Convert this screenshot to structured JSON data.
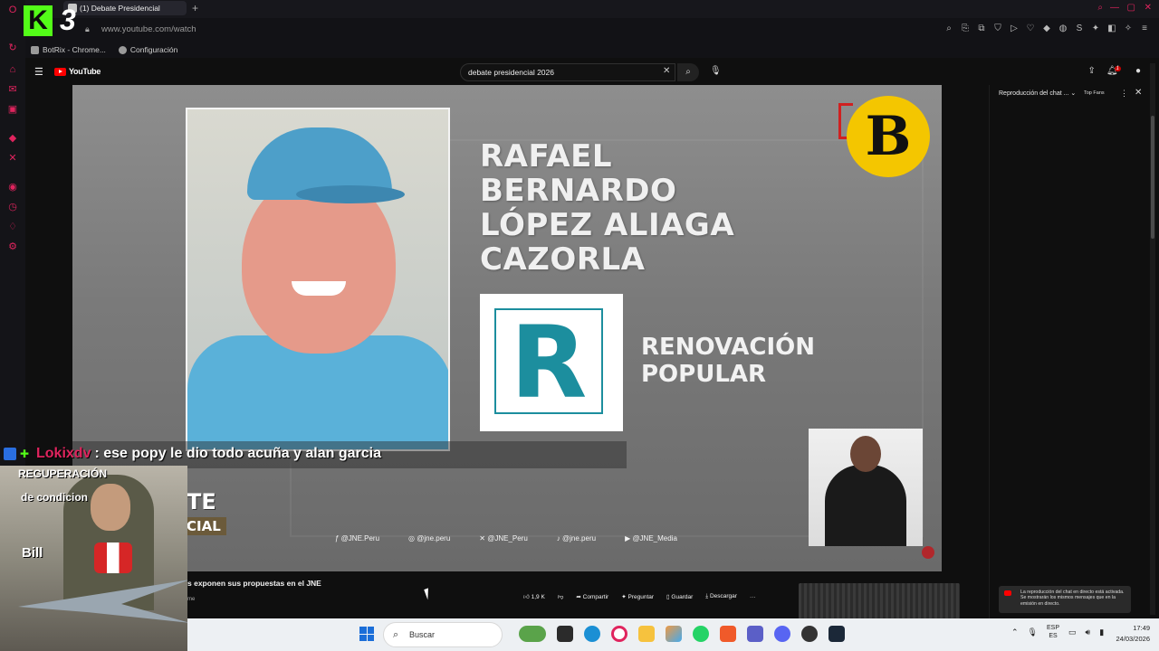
{
  "browser": {
    "tab_title": "(1) Debate Presidencial",
    "url": "www.youtube.com/watch",
    "bookmarks": [
      {
        "label": "BotRix - Chrome..."
      },
      {
        "label": "Configuración"
      }
    ]
  },
  "overlay": {
    "logo_k": "K",
    "logo_3": "3",
    "chat_user": "Lokixdv",
    "chat_message": ": ese popy le dio todo acuña y alan garcia",
    "cam_line1": "REGUPERACIÓN",
    "cam_line2": "de condicion",
    "cam_line3": "Bill"
  },
  "youtube": {
    "logo_text": "YouTube",
    "search_value": "debate presidencial 2026",
    "notification_count": "1"
  },
  "video": {
    "candidate_name": [
      "RAFAEL",
      "BERNARDO",
      "LÓPEZ ALIAGA",
      "CAZORLA"
    ],
    "party_letter": "R",
    "party_name": [
      "RENOVACIÓN",
      "POPULAR"
    ],
    "channel_logo_letter": "B",
    "debate_badge_line1": "TE",
    "debate_badge_line2": "CIAL",
    "socials": [
      "@JNE.Peru",
      "@jne.peru",
      "@JNE_Peru",
      "@jne.peru",
      "@JNE_Media"
    ],
    "title": "s exponen sus propuestas en el JNE",
    "subtitle": "me"
  },
  "actions": {
    "likes": "1,9 K",
    "share": "Compartir",
    "ask": "Preguntar",
    "save": "Guardar",
    "download": "Descargar",
    "more": "···"
  },
  "live_chat": {
    "header": "Reproducción del chat ...",
    "filter": "Top Fans",
    "notice": "La reproducción del chat en directo está activada. Se mostrarán los mismos mensajes que en la emisión en directo."
  },
  "taskbar": {
    "search_placeholder": "Buscar",
    "lang_line1": "ESP",
    "lang_line2": "ES",
    "time": "17:49",
    "date": "24/03/2026"
  },
  "colors": {
    "accent_kick": "#53fc18",
    "opera_red": "#e0245e",
    "youtube_red": "#ff0000",
    "party_teal": "#1c8e9e",
    "channel_yellow": "#f4c600"
  }
}
